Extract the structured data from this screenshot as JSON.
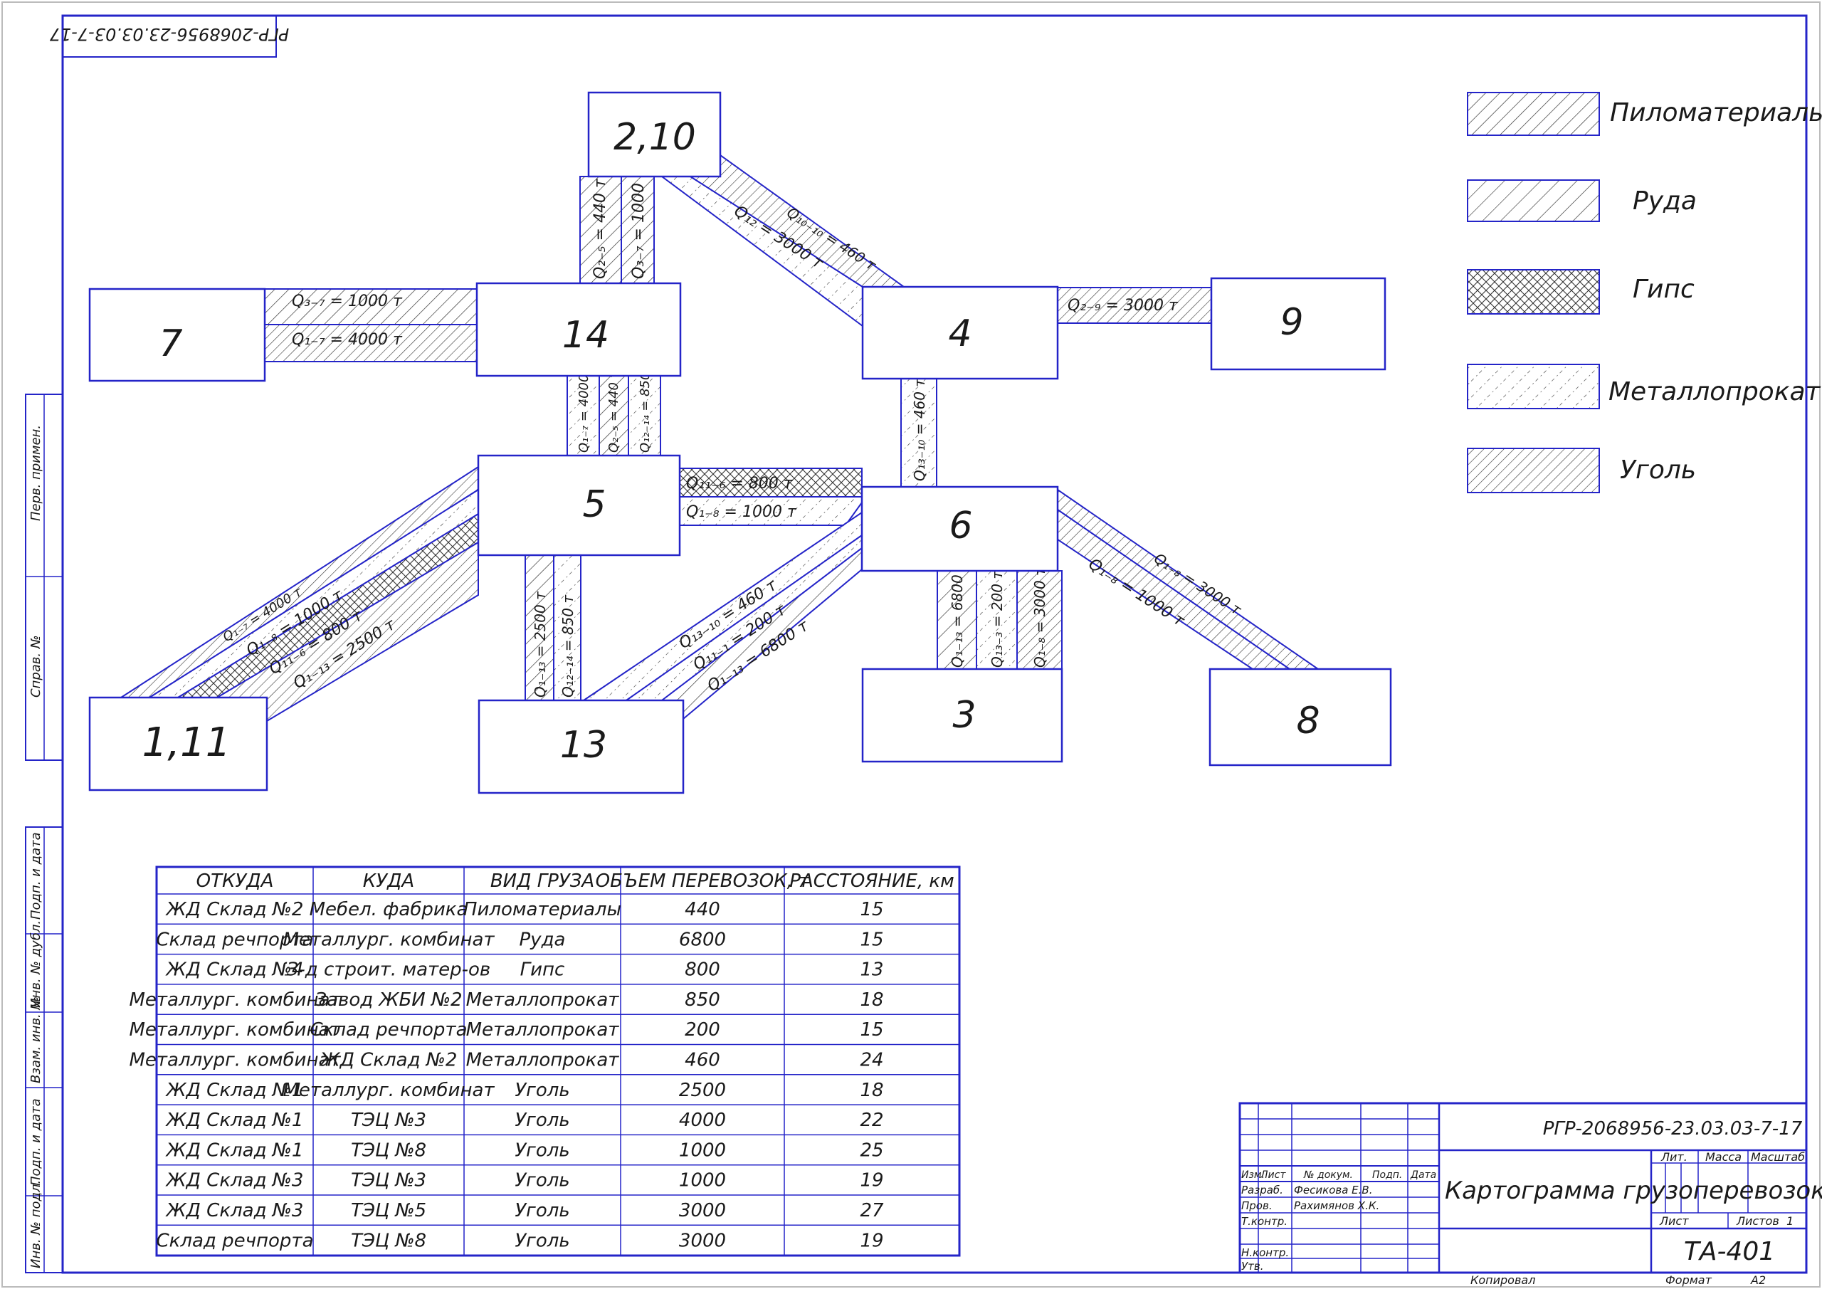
{
  "doc_code": "РГР-2068956-23.03.03-7-17",
  "doc_code_mirrored": "РГР-2068956-23.03.03-7-17",
  "nodes": {
    "n210": "2,10",
    "n7": "7",
    "n14": "14",
    "n4": "4",
    "n9": "9",
    "n5": "5",
    "n6": "6",
    "n111": "1,11",
    "n13": "13",
    "n3": "3",
    "n8": "8"
  },
  "flows": {
    "f2_14_a": "Q₂₋₅ = 440 т",
    "f2_14_b": "Q₃₋₇ = 1000 т",
    "f2_4_a": "Q₁₂ = 3000 т",
    "f2_4_b": "Q₁₀₋₁₀ = 460 т",
    "f7_14_a": "Q₃₋₇ = 1000 т",
    "f7_14_b": "Q₁₋₇ = 4000 т",
    "f4_9": "Q₂₋₉ = 3000 т",
    "f14_5_a": "Q₁₋₇ = 4000 т",
    "f14_5_b": "Q₂₋₅ = 440 т",
    "f14_5_c": "Q₁₂₋₁₄ = 850 т",
    "f4_6": "Q₁₃₋₁₀ = 460 т",
    "f5_6_a": "Q₁₁₋₆ = 800 т",
    "f5_6_b": "Q₁₋₈ = 1000 т",
    "f111_5_a": "Q₁₋₇ = 4000 т",
    "f111_5_b": "Q₁₋₈ = 1000 т",
    "f111_5_c": "Q₁₁₋₆ = 800 т",
    "f111_5_d": "Q₁₋₁₃ = 2500 т",
    "f5_13_a": "Q₁₋₁₃ = 2500 т",
    "f5_13_b": "Q₁₂₋₁₄ = 850 т",
    "f13_6_a": "Q₁₃₋₁₀ = 460 т",
    "f13_6_b": "Q₁₁₋₁ = 200 т",
    "f13_6_c": "Q₁₋₁₃ = 6800 т",
    "f6_3_a": "Q₁₋₁₃ = 6800 т",
    "f6_3_b": "Q₁₃₋₃ = 200 т",
    "f6_3_c": "Q₁₋₈ = 3000 т",
    "f6_8_a": "Q₁₋₈ = 1000 т",
    "f6_8_b": "Q₁₋₈ = 3000 т"
  },
  "legend": [
    {
      "pattern": "lumber",
      "label": "Пиломатериалы"
    },
    {
      "pattern": "ore",
      "label": "Руда"
    },
    {
      "pattern": "gypsum",
      "label": "Гипс"
    },
    {
      "pattern": "metal",
      "label": "Металлопрокат"
    },
    {
      "pattern": "coal",
      "label": "Уголь"
    }
  ],
  "table": {
    "headers": [
      "ОТКУДА",
      "КУДА",
      "ВИД ГРУЗА",
      "ОБЪЕМ ПЕРЕВОЗОК, т",
      "РАССТОЯНИЕ, км"
    ],
    "rows": [
      [
        "ЖД Склад №2",
        "Мебел. фабрика",
        "Пиломатериалы",
        "440",
        "15"
      ],
      [
        "Склад речпорта",
        "Металлург. комбинат",
        "Руда",
        "6800",
        "15"
      ],
      [
        "ЖД Склад №4",
        "З-д строит. матер-ов",
        "Гипс",
        "800",
        "13"
      ],
      [
        "Металлург. комбинат",
        "Завод ЖБИ №2",
        "Металлопрокат",
        "850",
        "18"
      ],
      [
        "Металлург. комбинат",
        "Склад речпорта",
        "Металлопрокат",
        "200",
        "15"
      ],
      [
        "Металлург. комбинат",
        "ЖД Склад №2",
        "Металлопрокат",
        "460",
        "24"
      ],
      [
        "ЖД Склад №1",
        "Металлург. комбинат",
        "Уголь",
        "2500",
        "18"
      ],
      [
        "ЖД Склад №1",
        "ТЭЦ №3",
        "Уголь",
        "4000",
        "22"
      ],
      [
        "ЖД Склад №1",
        "ТЭЦ №8",
        "Уголь",
        "1000",
        "25"
      ],
      [
        "ЖД Склад №3",
        "ТЭЦ №3",
        "Уголь",
        "1000",
        "19"
      ],
      [
        "ЖД Склад №3",
        "ТЭЦ №5",
        "Уголь",
        "3000",
        "27"
      ],
      [
        "Склад речпорта",
        "ТЭЦ №8",
        "Уголь",
        "3000",
        "19"
      ]
    ]
  },
  "side_labels": [
    "Перв. примен.",
    "Справ. №",
    "Подп. и дата",
    "Инв. № дубл.",
    "Взам. инв. №",
    "Подп. и дата",
    "Инв. № подл."
  ],
  "title_block": {
    "code": "РГР-2068956-23.03.03-7-17",
    "title": "Картограмма грузоперевозок",
    "col_izm": "Изм.",
    "col_list": "Лист",
    "col_doc": "№ докум.",
    "col_podp": "Подп.",
    "col_data": "Дата",
    "razrab": "Разраб.",
    "razrab_name": "Фесикова Е.В.",
    "prov": "Пров.",
    "prov_name": "Рахимянов Х.К.",
    "tkontr": "Т.контр.",
    "nkontr": "Н.контр.",
    "utv": "Утв.",
    "lit": "Лит.",
    "massa": "Масса",
    "masshtab": "Масштаб",
    "list_label": "Лист",
    "listov_label": "Листов",
    "listov_value": "1",
    "group": "ТА-401",
    "kopiroval": "Копировал",
    "format_label": "Формат",
    "format_value": "А2"
  }
}
